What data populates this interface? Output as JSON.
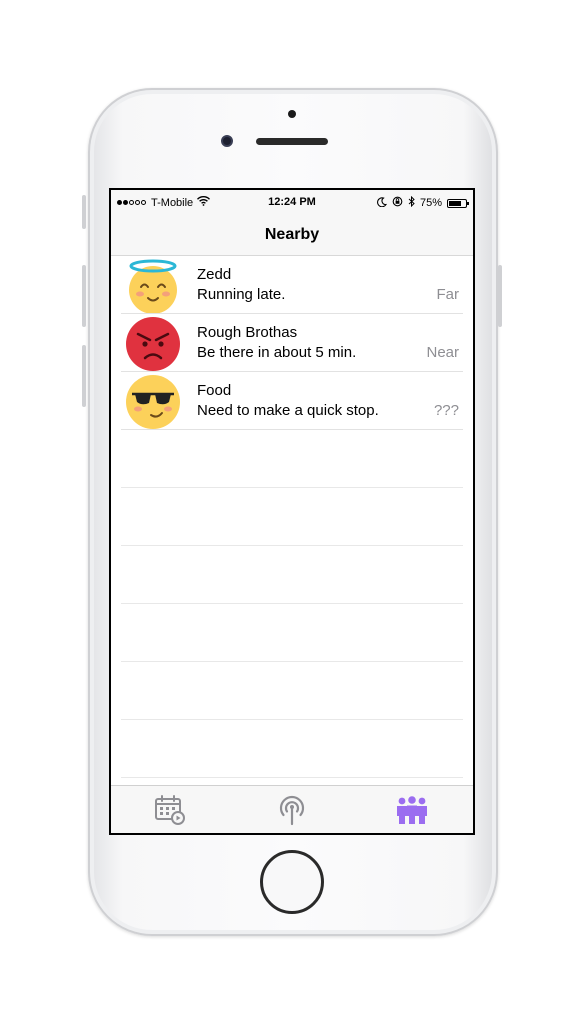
{
  "status_bar": {
    "carrier": "T-Mobile",
    "time": "12:24 PM",
    "battery": "75%",
    "battery_level": 0.75,
    "signal_bars_filled": 2,
    "signal_bars_total": 5,
    "icons": [
      "wifi-icon",
      "moon-icon",
      "rotation-lock-icon",
      "bluetooth-icon",
      "battery-icon"
    ]
  },
  "nav": {
    "title": "Nearby"
  },
  "contacts": [
    {
      "name": "Zedd",
      "message": "Running late.",
      "distance": "Far",
      "avatar": "angel-emoji-icon"
    },
    {
      "name": "Rough Brothas",
      "message": "Be there in about 5 min.",
      "distance": "Near",
      "avatar": "angry-emoji-icon"
    },
    {
      "name": "Food",
      "message": "Need to make a quick stop.",
      "distance": "???",
      "avatar": "sunglasses-emoji-icon"
    }
  ],
  "tabs": [
    {
      "icon": "calendar-icon",
      "active": false
    },
    {
      "icon": "broadcast-icon",
      "active": false
    },
    {
      "icon": "people-icon",
      "active": true
    }
  ],
  "colors": {
    "tab_active": "#9b6df0",
    "tab_inactive": "#8e8e93",
    "secondary_text": "#8e8e93"
  }
}
